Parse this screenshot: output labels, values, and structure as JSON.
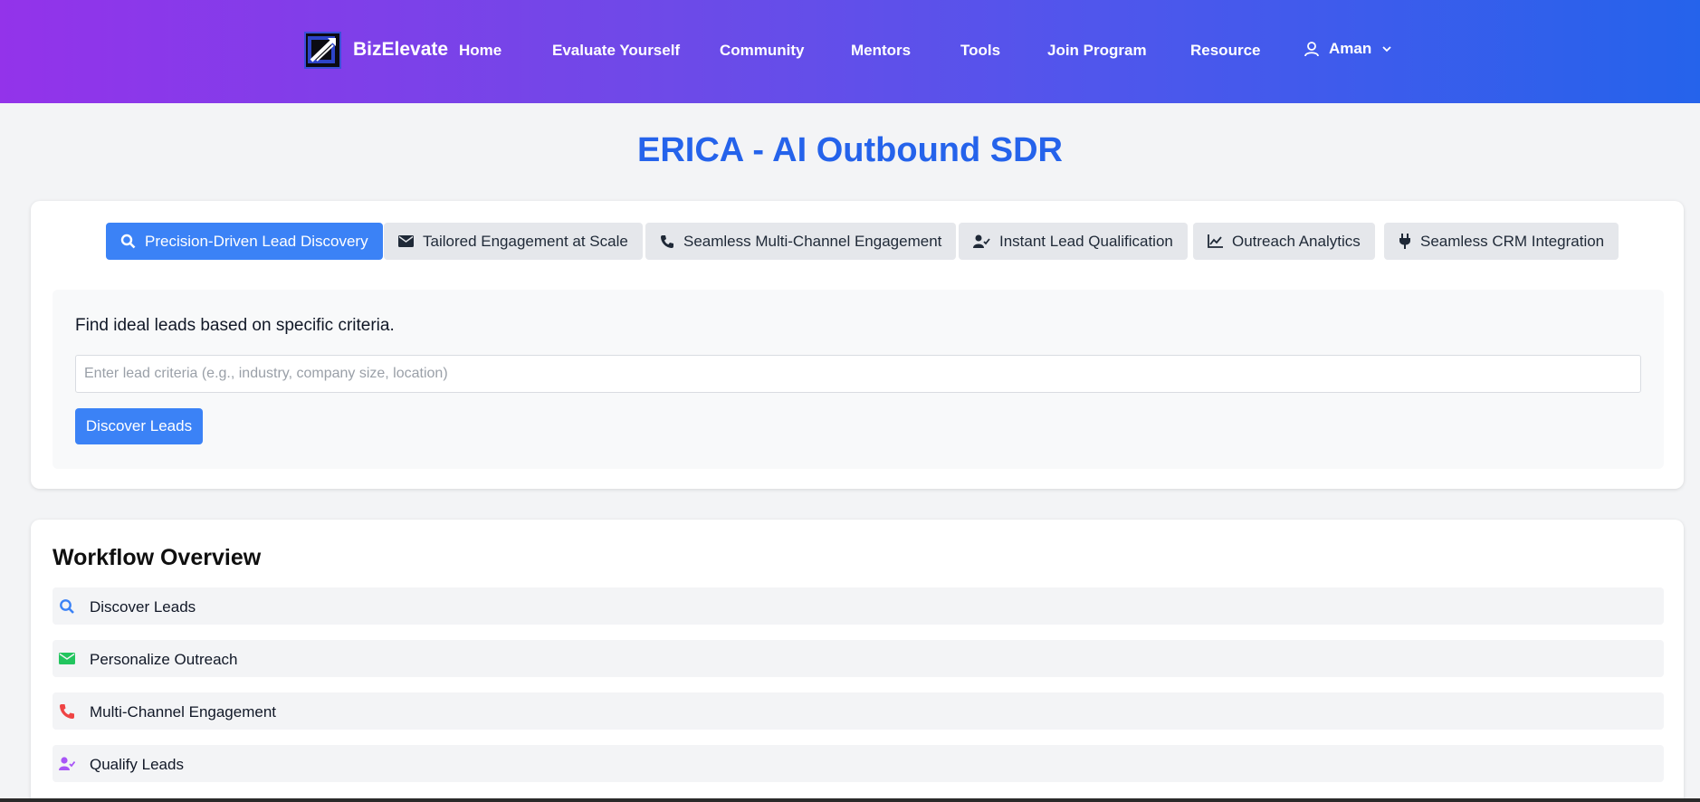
{
  "header": {
    "brand": "BizElevate",
    "nav": [
      "Home",
      "Evaluate Yourself",
      "Community",
      "Mentors",
      "Tools",
      "Join Program",
      "Resource"
    ],
    "user_name": "Aman"
  },
  "page": {
    "title": "ERICA - AI Outbound SDR"
  },
  "tabs": [
    {
      "label": "Precision-Driven Lead Discovery",
      "icon": "search-icon",
      "active": true
    },
    {
      "label": "Tailored Engagement at Scale",
      "icon": "envelope-icon",
      "active": false
    },
    {
      "label": "Seamless Multi-Channel Engagement",
      "icon": "phone-icon",
      "active": false
    },
    {
      "label": "Instant Lead Qualification",
      "icon": "user-check-icon",
      "active": false
    },
    {
      "label": "Outreach Analytics",
      "icon": "chart-line-icon",
      "active": false
    },
    {
      "label": "Seamless CRM Integration",
      "icon": "plug-icon",
      "active": false
    }
  ],
  "panel": {
    "description": "Find ideal leads based on specific criteria.",
    "input_placeholder": "Enter lead criteria (e.g., industry, company size, location)",
    "input_value": "",
    "button_label": "Discover Leads"
  },
  "workflow": {
    "title": "Workflow Overview",
    "steps": [
      {
        "label": "Discover Leads",
        "icon": "search-icon",
        "color": "#3b82f6"
      },
      {
        "label": "Personalize Outreach",
        "icon": "envelope-icon",
        "color": "#22c55e"
      },
      {
        "label": "Multi-Channel Engagement",
        "icon": "phone-icon",
        "color": "#ef4444"
      },
      {
        "label": "Qualify Leads",
        "icon": "user-check-icon",
        "color": "#a855f7"
      }
    ]
  },
  "colors": {
    "accent": "#3b82f6",
    "title": "#2563eb"
  }
}
